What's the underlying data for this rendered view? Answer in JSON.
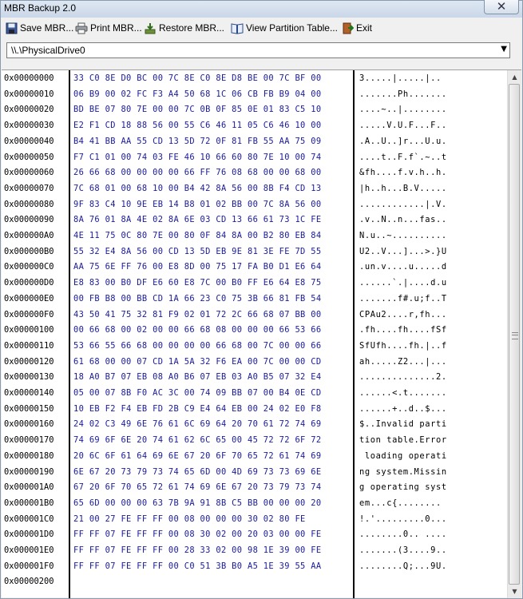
{
  "window": {
    "title": "MBR Backup 2.0",
    "close_label": "✕"
  },
  "toolbar": {
    "save": "Save MBR...",
    "print": "Print MBR...",
    "restore": "Restore MBR...",
    "view": "View Partition Table...",
    "exit": "Exit"
  },
  "drive_select": {
    "value": "\\\\.\\PhysicalDrive0"
  },
  "hex": {
    "rows": [
      {
        "offset": "0x00000000",
        "hex": "33 C0 8E D0 BC 00 7C 8E C0 8E D8 BE 00 7C BF 00",
        "ascii": "3.....|.....|.."
      },
      {
        "offset": "0x00000010",
        "hex": "06 B9 00 02 FC F3 A4 50 68 1C 06 CB FB B9 04 00",
        "ascii": ".......Ph......."
      },
      {
        "offset": "0x00000020",
        "hex": "BD BE 07 80 7E 00 00 7C 0B 0F 85 0E 01 83 C5 10",
        "ascii": "....~..|........"
      },
      {
        "offset": "0x00000030",
        "hex": "E2 F1 CD 18 88 56 00 55 C6 46 11 05 C6 46 10 00",
        "ascii": ".....V.U.F...F.."
      },
      {
        "offset": "0x00000040",
        "hex": "B4 41 BB AA 55 CD 13 5D 72 0F 81 FB 55 AA 75 09",
        "ascii": ".A..U..]r...U.u."
      },
      {
        "offset": "0x00000050",
        "hex": "F7 C1 01 00 74 03 FE 46 10 66 60 80 7E 10 00 74",
        "ascii": "....t..F.f`.~..t"
      },
      {
        "offset": "0x00000060",
        "hex": "26 66 68 00 00 00 00 66 FF 76 08 68 00 00 68 00",
        "ascii": "&fh....f.v.h..h."
      },
      {
        "offset": "0x00000070",
        "hex": "7C 68 01 00 68 10 00 B4 42 8A 56 00 8B F4 CD 13",
        "ascii": "|h..h...B.V....."
      },
      {
        "offset": "0x00000080",
        "hex": "9F 83 C4 10 9E EB 14 B8 01 02 BB 00 7C 8A 56 00",
        "ascii": "............|.V."
      },
      {
        "offset": "0x00000090",
        "hex": "8A 76 01 8A 4E 02 8A 6E 03 CD 13 66 61 73 1C FE",
        "ascii": ".v..N..n...fas.."
      },
      {
        "offset": "0x000000A0",
        "hex": "4E 11 75 0C 80 7E 00 80 0F 84 8A 00 B2 80 EB 84",
        "ascii": "N.u..~.........."
      },
      {
        "offset": "0x000000B0",
        "hex": "55 32 E4 8A 56 00 CD 13 5D EB 9E 81 3E FE 7D 55",
        "ascii": "U2..V...]...>.}U"
      },
      {
        "offset": "0x000000C0",
        "hex": "AA 75 6E FF 76 00 E8 8D 00 75 17 FA B0 D1 E6 64",
        "ascii": ".un.v....u.....d"
      },
      {
        "offset": "0x000000D0",
        "hex": "E8 83 00 B0 DF E6 60 E8 7C 00 B0 FF E6 64 E8 75",
        "ascii": "......`.|....d.u"
      },
      {
        "offset": "0x000000E0",
        "hex": "00 FB B8 00 BB CD 1A 66 23 C0 75 3B 66 81 FB 54",
        "ascii": ".......f#.u;f..T"
      },
      {
        "offset": "0x000000F0",
        "hex": "43 50 41 75 32 81 F9 02 01 72 2C 66 68 07 BB 00",
        "ascii": "CPAu2....r,fh..."
      },
      {
        "offset": "0x00000100",
        "hex": "00 66 68 00 02 00 00 66 68 08 00 00 00 66 53 66",
        "ascii": ".fh....fh....fSf"
      },
      {
        "offset": "0x00000110",
        "hex": "53 66 55 66 68 00 00 00 00 66 68 00 7C 00 00 66",
        "ascii": "SfUfh....fh.|..f"
      },
      {
        "offset": "0x00000120",
        "hex": "61 68 00 00 07 CD 1A 5A 32 F6 EA 00 7C 00 00 CD",
        "ascii": "ah.....Z2...|..."
      },
      {
        "offset": "0x00000130",
        "hex": "18 A0 B7 07 EB 08 A0 B6 07 EB 03 A0 B5 07 32 E4",
        "ascii": "..............2."
      },
      {
        "offset": "0x00000140",
        "hex": "05 00 07 8B F0 AC 3C 00 74 09 BB 07 00 B4 0E CD",
        "ascii": "......<.t......."
      },
      {
        "offset": "0x00000150",
        "hex": "10 EB F2 F4 EB FD 2B C9 E4 64 EB 00 24 02 E0 F8",
        "ascii": "......+..d..$..."
      },
      {
        "offset": "0x00000160",
        "hex": "24 02 C3 49 6E 76 61 6C 69 64 20 70 61 72 74 69",
        "ascii": "$..Invalid parti"
      },
      {
        "offset": "0x00000170",
        "hex": "74 69 6F 6E 20 74 61 62 6C 65 00 45 72 72 6F 72",
        "ascii": "tion table.Error"
      },
      {
        "offset": "0x00000180",
        "hex": "20 6C 6F 61 64 69 6E 67 20 6F 70 65 72 61 74 69",
        "ascii": " loading operati"
      },
      {
        "offset": "0x00000190",
        "hex": "6E 67 20 73 79 73 74 65 6D 00 4D 69 73 73 69 6E",
        "ascii": "ng system.Missin"
      },
      {
        "offset": "0x000001A0",
        "hex": "67 20 6F 70 65 72 61 74 69 6E 67 20 73 79 73 74",
        "ascii": "g operating syst"
      },
      {
        "offset": "0x000001B0",
        "hex": "65 6D 00 00 00 63 7B 9A 91 8B C5 BB 00 00 00 20",
        "ascii": "em...c{........ "
      },
      {
        "offset": "0x000001C0",
        "hex": "21 00 27 FE FF FF 00 08 00 00 00 30 02 80 FE",
        "ascii": "!.'.........0..."
      },
      {
        "offset": "0x000001D0",
        "hex": "FF FF 07 FE FF FF 00 08 30 02 00 20 03 00 00 FE",
        "ascii": "........0.. ...."
      },
      {
        "offset": "0x000001E0",
        "hex": "FF FF 07 FE FF FF 00 28 33 02 00 98 1E 39 00 FE",
        "ascii": ".......(3....9.."
      },
      {
        "offset": "0x000001F0",
        "hex": "FF FF 07 FE FF FF 00 C0 51 3B B0 A5 1E 39 55 AA",
        "ascii": "........Q;...9U."
      },
      {
        "offset": "0x00000200",
        "hex": "",
        "ascii": ""
      }
    ]
  }
}
